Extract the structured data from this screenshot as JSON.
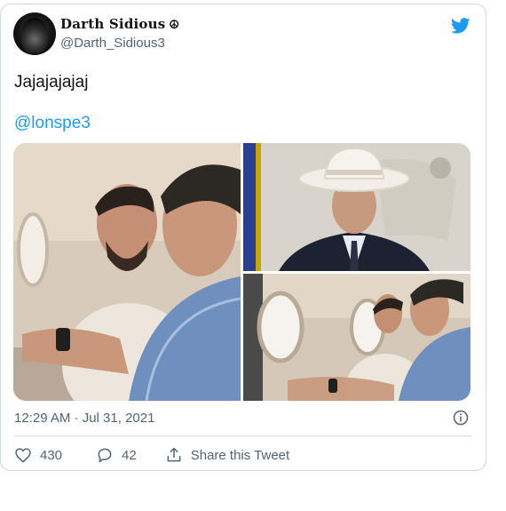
{
  "tweet": {
    "author": {
      "name": "Darth Sidious",
      "name_icon": "☮",
      "handle": "@Darth_Sidious3",
      "avatar_icon": "hooded-figure-avatar"
    },
    "logo_icon": "twitter-bird-icon",
    "text": "Jajajajajaj",
    "mention": "@lonspe3",
    "timestamp": "12:29 AM · Jul 31, 2021",
    "likes": "430",
    "replies": "42",
    "share_label": "Share this Tweet"
  },
  "colors": {
    "brand": "#1d9bf0",
    "text": "#0f1419",
    "secondary": "#536471",
    "border": "#cfd9de"
  },
  "icons": {
    "like": "heart-icon",
    "reply": "reply-icon",
    "share": "share-icon",
    "info": "info-icon"
  }
}
